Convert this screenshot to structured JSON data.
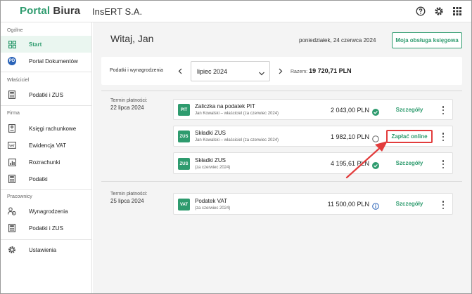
{
  "header": {
    "logo_part1": "Portal",
    "logo_part2": "Biura",
    "company": "InsERT S.A.",
    "icons": [
      "help-icon",
      "settings-icon",
      "apps-grid-icon"
    ]
  },
  "sidebar": {
    "sections": [
      {
        "label": "Ogólne",
        "items": [
          {
            "label": "Start",
            "icon": "dashboard-icon",
            "active": true
          },
          {
            "label": "Portal Dokumentów",
            "icon": "pd-badge"
          }
        ]
      },
      {
        "label": "Właściciel",
        "items": [
          {
            "label": "Podatki i ZUS",
            "icon": "calculator-icon"
          }
        ]
      },
      {
        "label": "Firma",
        "items": [
          {
            "label": "Księgi rachunkowe",
            "icon": "ledger-icon"
          },
          {
            "label": "Ewidencja VAT",
            "icon": "vat-icon"
          },
          {
            "label": "Rozrachunki",
            "icon": "chart-icon"
          },
          {
            "label": "Podatki",
            "icon": "calculator-icon"
          }
        ]
      },
      {
        "label": "Pracownicy",
        "items": [
          {
            "label": "Wynagrodzenia",
            "icon": "payroll-icon"
          },
          {
            "label": "Podatki i ZUS",
            "icon": "calculator-icon"
          }
        ]
      },
      {
        "label": "",
        "items": [
          {
            "label": "Ustawienia",
            "icon": "gear-icon"
          }
        ]
      }
    ]
  },
  "main": {
    "welcome": "Witaj, Jan",
    "date": "poniedziałek, 24 czerwca 2024",
    "accountant_button": "Moja obsługa księgowa",
    "filter": {
      "label": "Podatki i wynagrodzenia",
      "period": "lipiec 2024",
      "total_label": "Razem:",
      "total_value": "19 720,71 PLN"
    },
    "groups": [
      {
        "term_label": "Termin płatności:",
        "term_date": "22 lipca 2024",
        "items": [
          {
            "badge": "PIT",
            "title": "Zaliczka na podatek PIT",
            "subtitle": "Jan Kowalski – właściciel (za czerwiec 2024)",
            "amount": "2 043,00 PLN",
            "status": "paid",
            "action": "Szczegóły"
          },
          {
            "badge": "ZUS",
            "title": "Składki ZUS",
            "subtitle": "Jan Kowalski – właściciel (za czerwiec 2024)",
            "amount": "1 982,10 PLN",
            "status": "unpaid",
            "action": "Zapłać online"
          },
          {
            "badge": "ZUS",
            "title": "Składki ZUS",
            "subtitle": "(za czerwiec 2024)",
            "amount": "4 195,61 PLN",
            "status": "paid",
            "action": "Szczegóły"
          }
        ]
      },
      {
        "term_label": "Termin płatności:",
        "term_date": "25 lipca 2024",
        "items": [
          {
            "badge": "VAT",
            "title": "Podatek VAT",
            "subtitle": "(za czerwiec 2024)",
            "amount": "11 500,00 PLN",
            "status": "info",
            "action": "Szczegóły"
          }
        ]
      }
    ]
  },
  "colors": {
    "brand_green": "#2e9b6e",
    "annotation_red": "#e23c3c",
    "info_blue": "#2a63b8"
  }
}
